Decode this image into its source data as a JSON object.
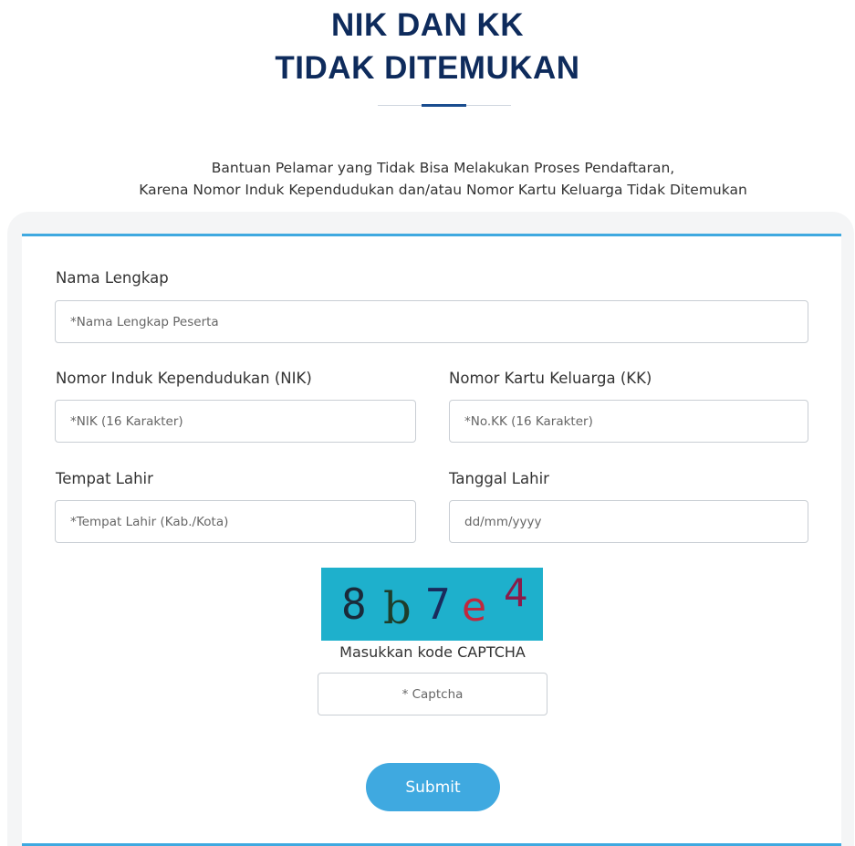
{
  "header": {
    "title_line1": "NIK DAN KK",
    "title_line2": "TIDAK DITEMUKAN"
  },
  "intro": {
    "line1": "Bantuan Pelamar yang Tidak Bisa Melakukan Proses Pendaftaran,",
    "line2": "Karena Nomor Induk Kependudukan dan/atau Nomor Kartu Keluarga Tidak Ditemukan"
  },
  "form": {
    "full_name": {
      "label": "Nama Lengkap",
      "placeholder": "*Nama Lengkap Peserta",
      "value": ""
    },
    "nik": {
      "label": "Nomor Induk Kependudukan (NIK)",
      "placeholder": "*NIK (16 Karakter)",
      "value": ""
    },
    "kk": {
      "label": "Nomor Kartu Keluarga (KK)",
      "placeholder": "*No.KK (16 Karakter)",
      "value": ""
    },
    "birthplace": {
      "label": "Tempat Lahir",
      "placeholder": "*Tempat Lahir (Kab./Kota)",
      "value": ""
    },
    "birthdate": {
      "label": "Tanggal Lahir",
      "placeholder": "dd/mm/yyyy",
      "value": ""
    },
    "captcha": {
      "image_text": "8b7e4",
      "chars": [
        {
          "char": "8",
          "color": "#1a2a3a"
        },
        {
          "char": "b",
          "color": "#1e3d2a"
        },
        {
          "char": "7",
          "color": "#1a2a5c"
        },
        {
          "char": "e",
          "color": "#c0283e"
        },
        {
          "char": "4",
          "color": "#8a1c4a"
        }
      ],
      "caption": "Masukkan kode CAPTCHA",
      "placeholder": "* Captcha",
      "value": ""
    },
    "submit_label": "Submit"
  },
  "colors": {
    "title": "#0e2b5c",
    "accent": "#3fa9e0",
    "captcha_bg": "#1eb0cc"
  }
}
